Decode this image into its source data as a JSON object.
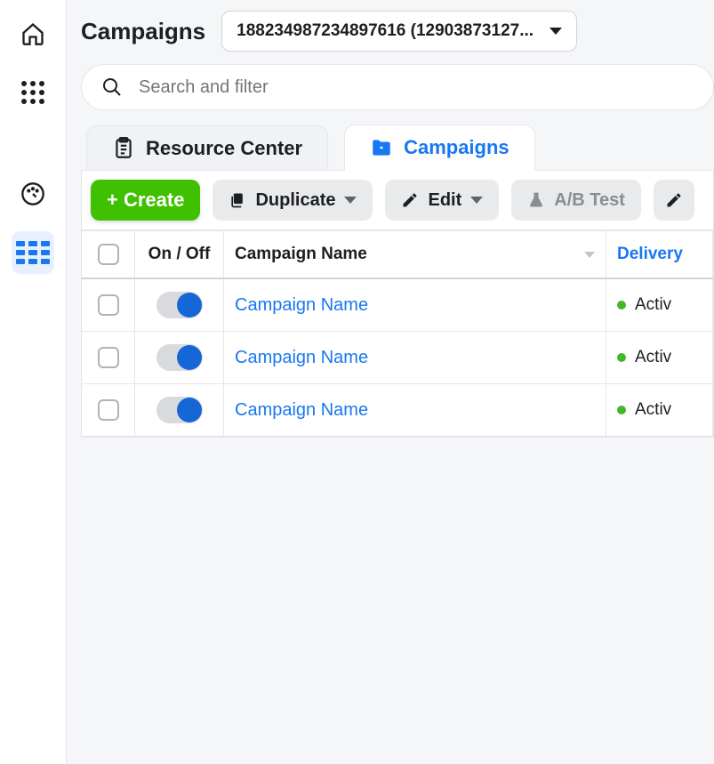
{
  "header": {
    "title": "Campaigns",
    "account_selector_value": "188234987234897616 (12903873127..."
  },
  "search": {
    "placeholder": "Search and filter"
  },
  "tabs": {
    "resource_center": "Resource Center",
    "campaigns": "Campaigns"
  },
  "toolbar": {
    "create": "+ Create",
    "duplicate": "Duplicate",
    "edit": "Edit",
    "ab_test": "A/B Test"
  },
  "table": {
    "columns": {
      "onoff": "On / Off",
      "name": "Campaign Name",
      "delivery": "Delivery"
    },
    "rows": [
      {
        "name": "Campaign Name",
        "delivery": "Activ"
      },
      {
        "name": "Campaign Name",
        "delivery": "Activ"
      },
      {
        "name": "Campaign Name",
        "delivery": "Activ"
      }
    ]
  }
}
